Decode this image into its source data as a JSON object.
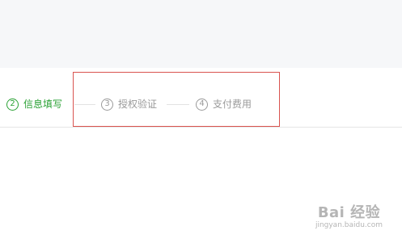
{
  "steps": [
    {
      "number": "2",
      "label": "信息填写",
      "state": "active"
    },
    {
      "number": "3",
      "label": "授权验证",
      "state": "inactive"
    },
    {
      "number": "4",
      "label": "支付费用",
      "state": "inactive"
    }
  ],
  "colors": {
    "active": "#2aa134",
    "inactive": "#9a9a9a",
    "highlight_border": "#d9534f",
    "top_band": "#f6f7f9"
  },
  "watermark": {
    "main": "Bai 经验",
    "sub": "jingyan.baidu.com"
  }
}
